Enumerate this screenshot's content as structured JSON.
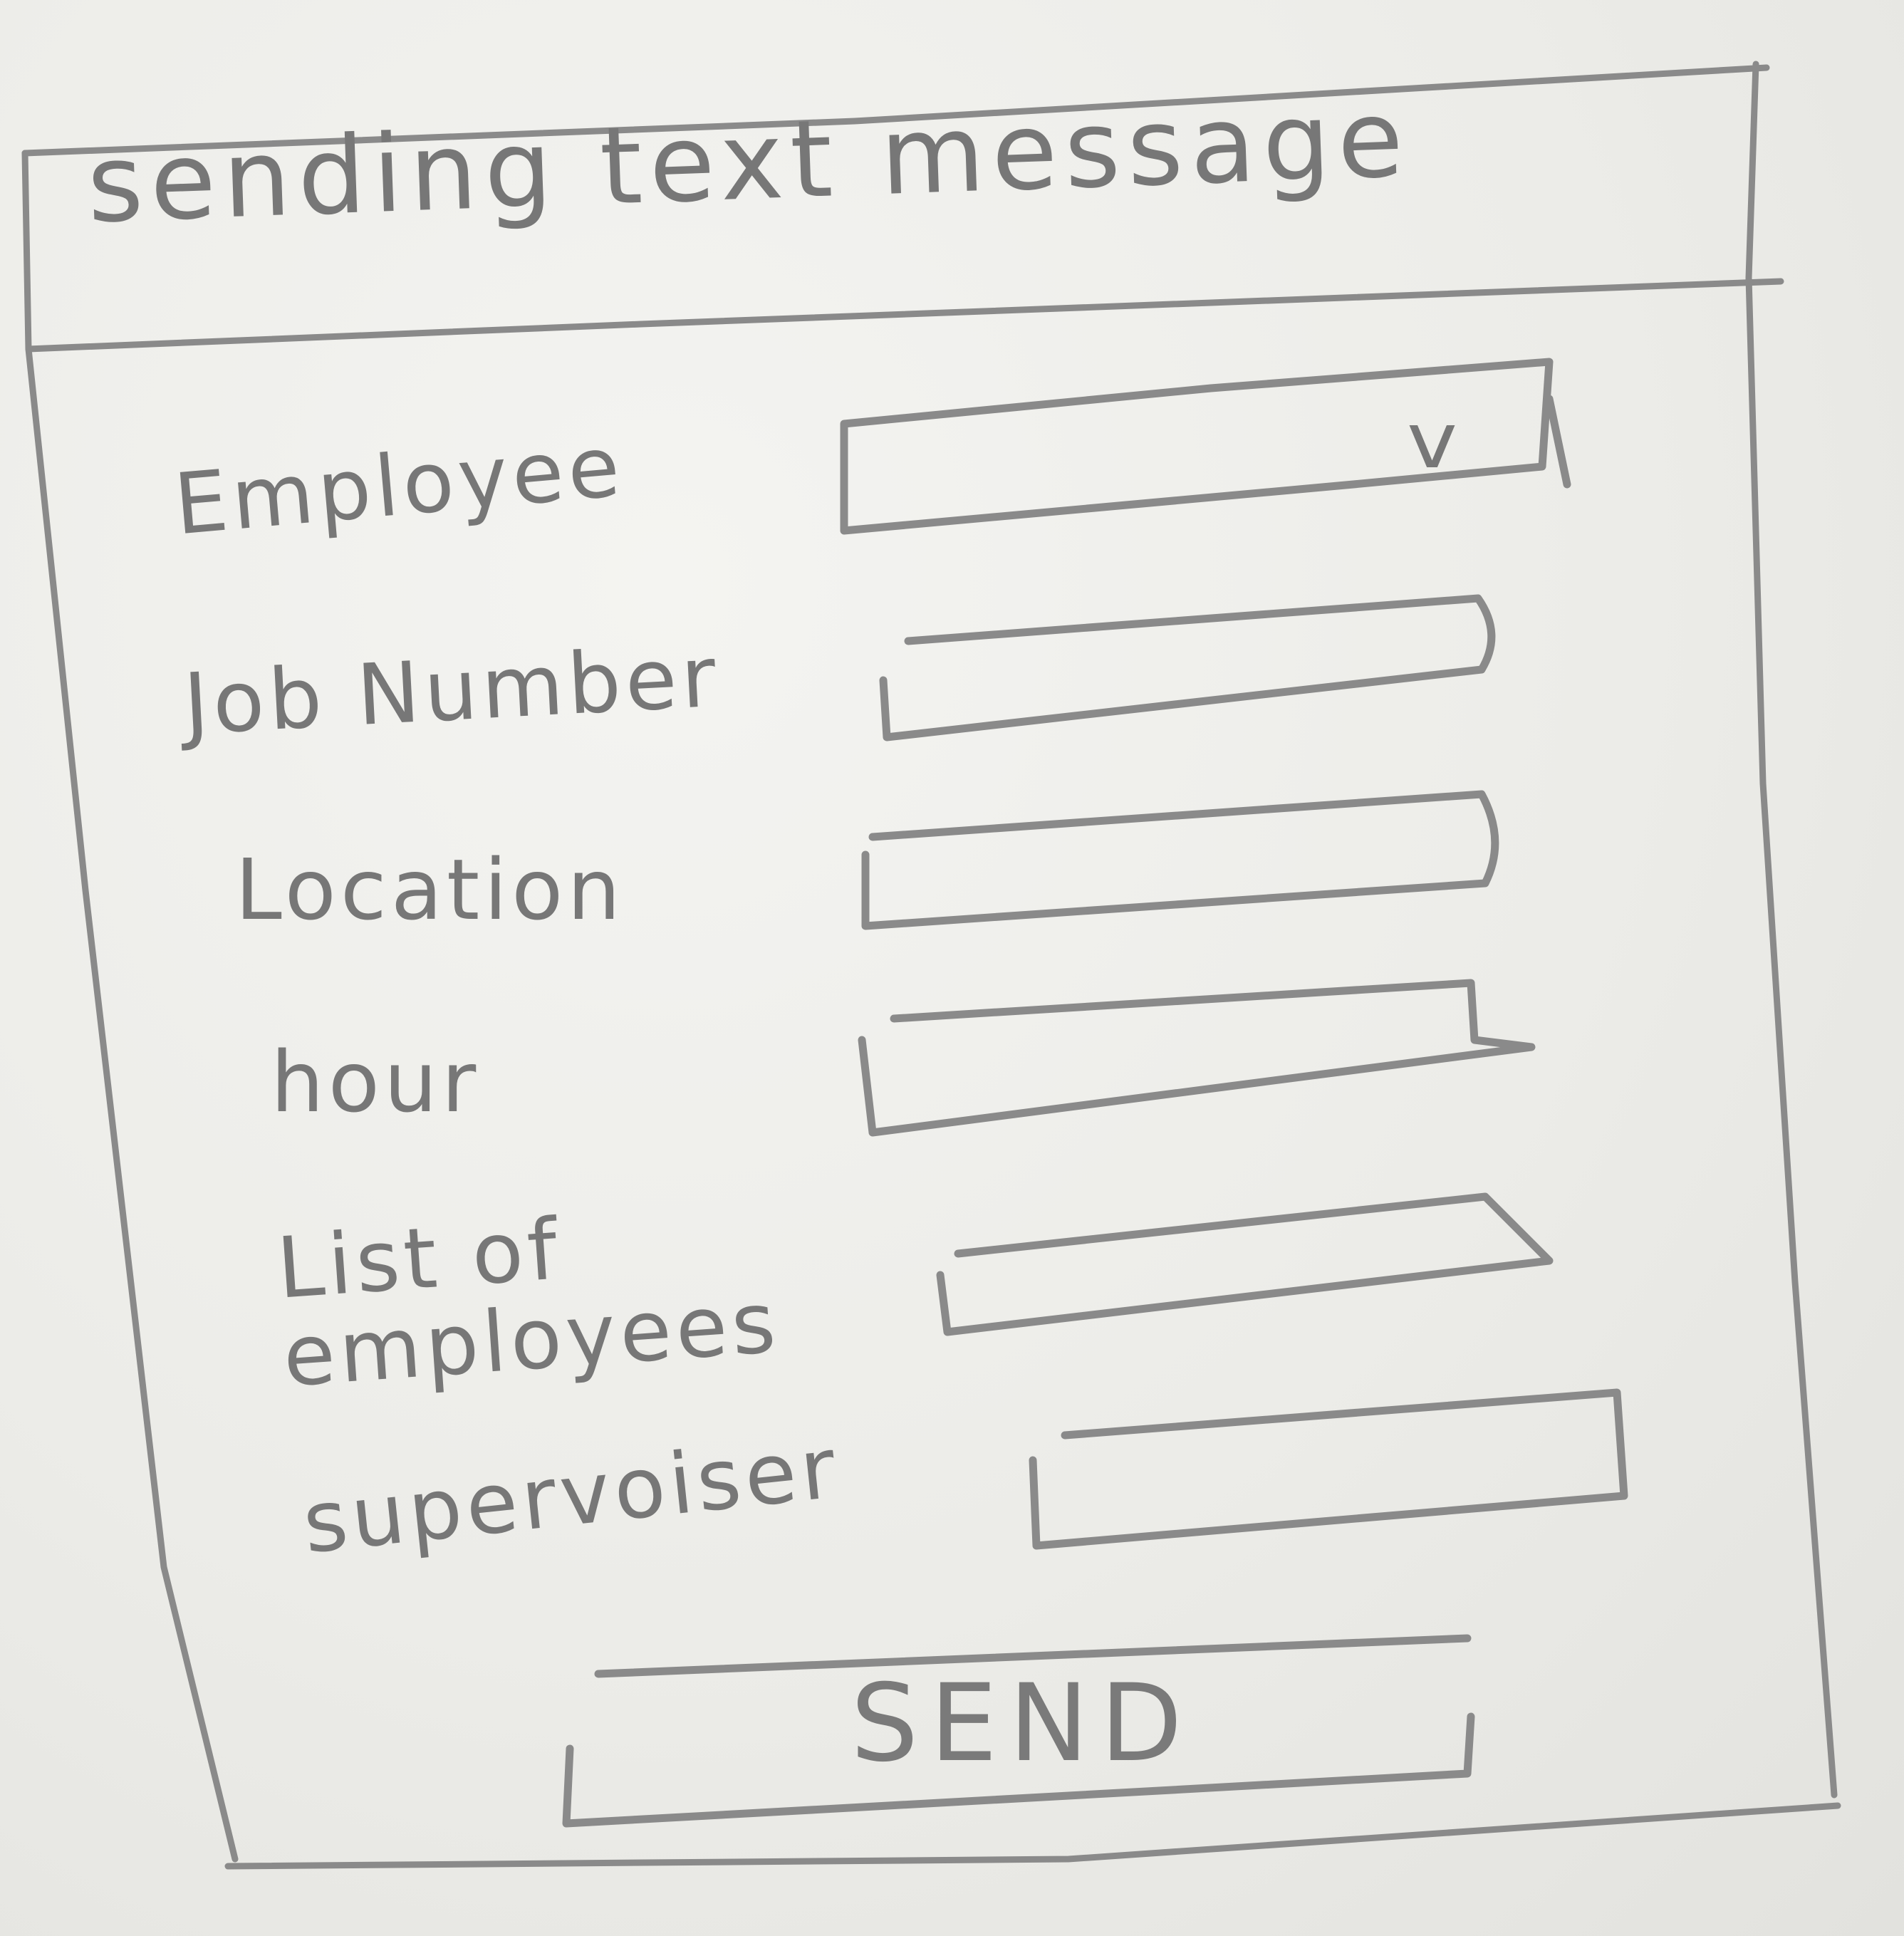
{
  "window": {
    "title": "sending text message"
  },
  "form": {
    "fields": [
      {
        "label": "Employee",
        "control": "dropdown",
        "value": "",
        "icon": "chevron-down-icon"
      },
      {
        "label": "Job Number",
        "control": "text",
        "value": ""
      },
      {
        "label": "Location",
        "control": "text",
        "value": ""
      },
      {
        "label": "hour",
        "control": "text",
        "value": ""
      },
      {
        "label": "List of employees",
        "control": "text",
        "value": ""
      },
      {
        "label": "supervoiser",
        "control": "text",
        "value": ""
      }
    ],
    "dropdown_glyph": "v",
    "send_label": "SEND"
  },
  "colors": {
    "pencil": "#8a8a8a",
    "paper": "#ececE8"
  }
}
